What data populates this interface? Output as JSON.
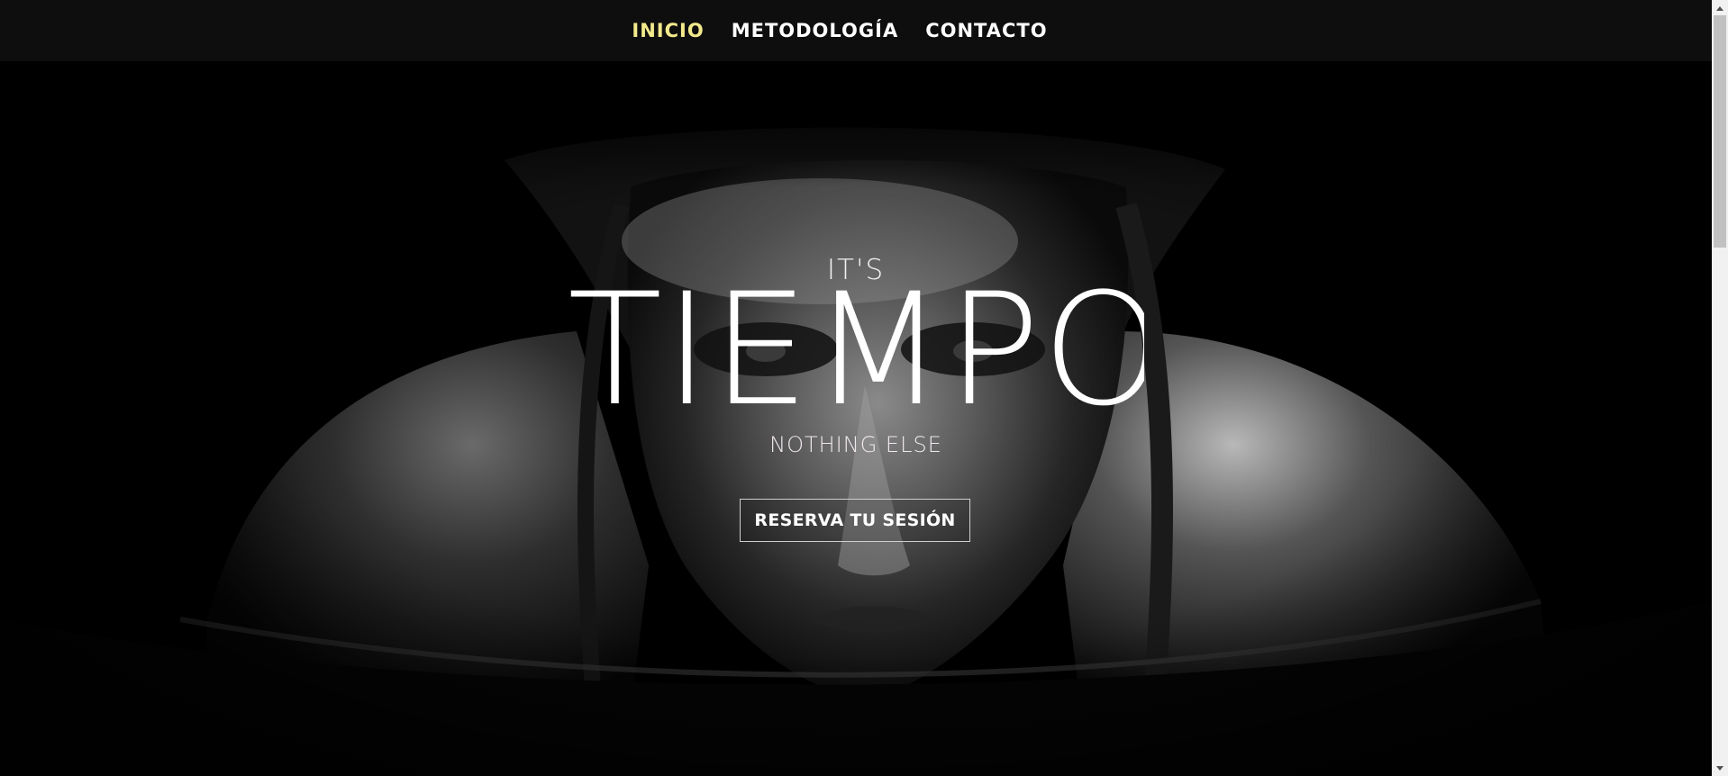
{
  "nav": {
    "items": [
      {
        "label": "INICIO",
        "active": true
      },
      {
        "label": "METODOLOGÍA",
        "active": false
      },
      {
        "label": "CONTACTO",
        "active": false
      }
    ],
    "active_color": "#f2e98c"
  },
  "hero": {
    "eyebrow": "IT'S",
    "title": "TIEMPO",
    "subtitle": "NOTHING ELSE",
    "cta_label": "RESERVA TU SESIÓN",
    "photo_icon": "athlete-portrait-image"
  },
  "scrollbar": {
    "up_icon": "arrow-up-icon",
    "down_icon": "arrow-down-icon"
  }
}
